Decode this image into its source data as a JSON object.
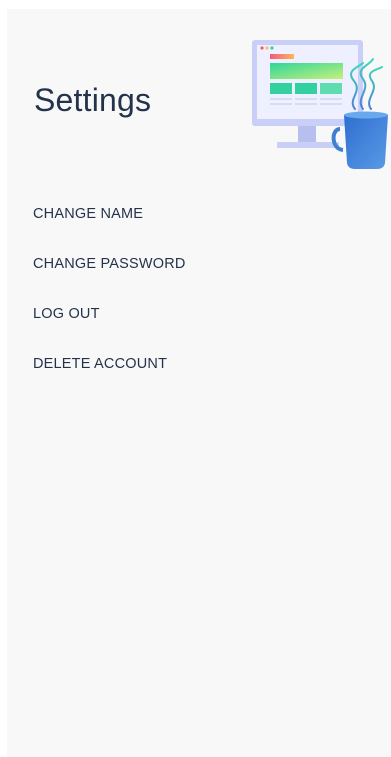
{
  "header": {
    "title": "Settings",
    "illustration": "desktop-monitor-with-coffee-mug-illustration"
  },
  "menu": {
    "items": [
      {
        "id": "change-name",
        "label": "CHANGE NAME"
      },
      {
        "id": "change-password",
        "label": "CHANGE PASSWORD"
      },
      {
        "id": "log-out",
        "label": "LOG OUT"
      },
      {
        "id": "delete-account",
        "label": "DELETE ACCOUNT"
      }
    ]
  },
  "colors": {
    "background": "#f8f8f9",
    "text": "#24334b",
    "monitor": "#c9cff7",
    "mug": "#3d7fd1",
    "steam": "#5b8fd9",
    "accent_green": "#34d1a0"
  }
}
